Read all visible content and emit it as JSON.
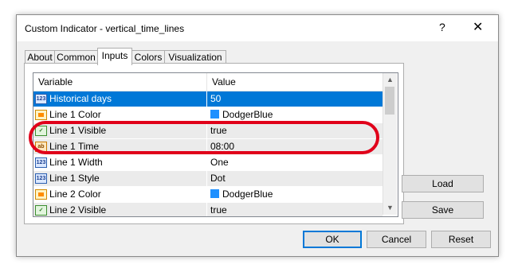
{
  "window": {
    "title": "Custom Indicator - vertical_time_lines",
    "help": "?",
    "close": "✕"
  },
  "tabs": [
    "About",
    "Common",
    "Inputs",
    "Colors",
    "Visualization"
  ],
  "grid": {
    "headers": {
      "variable": "Variable",
      "value": "Value"
    },
    "rows": [
      {
        "icon": "number-icon",
        "iconText": "123",
        "variable": "Historical days",
        "value": "50"
      },
      {
        "icon": "color-icon",
        "iconText": "",
        "variable": "Line 1  Color",
        "value": "DodgerBlue",
        "swatch": "#1e90ff"
      },
      {
        "icon": "bool-icon",
        "iconText": "✓",
        "variable": "Line 1  Visible",
        "value": "true"
      },
      {
        "icon": "string-icon",
        "iconText": "ab",
        "variable": "Line 1  Time",
        "value": "08:00"
      },
      {
        "icon": "number-icon",
        "iconText": "123",
        "variable": "Line 1  Width",
        "value": "One"
      },
      {
        "icon": "number-icon",
        "iconText": "123",
        "variable": "Line 1  Style",
        "value": "Dot"
      },
      {
        "icon": "color-icon",
        "iconText": "",
        "variable": "Line 2  Color",
        "value": "DodgerBlue",
        "swatch": "#1e90ff"
      },
      {
        "icon": "bool-icon",
        "iconText": "✓",
        "variable": "Line 2  Visible",
        "value": "true"
      }
    ]
  },
  "buttons": {
    "load": "Load",
    "save": "Save",
    "ok": "OK",
    "cancel": "Cancel",
    "reset": "Reset"
  },
  "colors": {
    "selection": "#0078d7",
    "highlight_ring": "#e0001a",
    "dodger_blue": "#1e90ff"
  }
}
